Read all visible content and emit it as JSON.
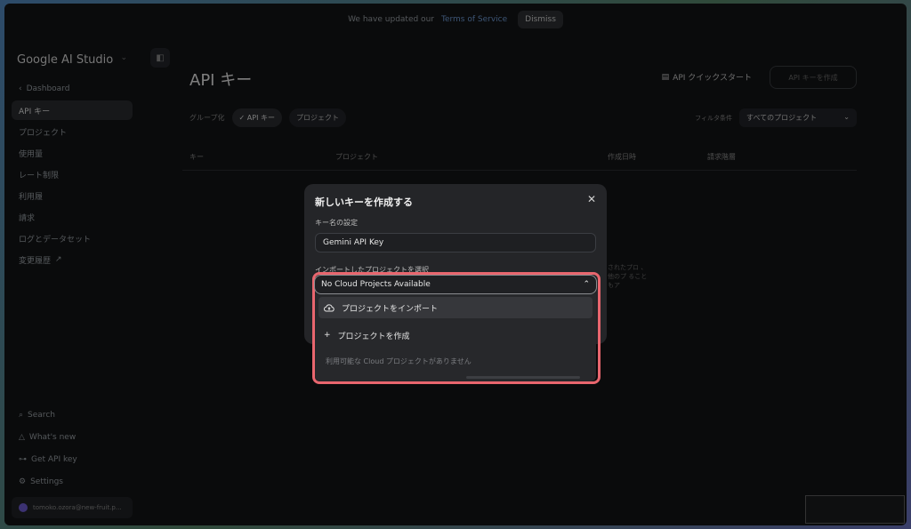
{
  "banner": {
    "text": "We have updated our",
    "link": "Terms of Service",
    "dismiss": "Dismiss"
  },
  "sidebar": {
    "logo": "Google AI Studio",
    "items": [
      {
        "label": "Dashboard"
      },
      {
        "label": "API キー"
      },
      {
        "label": "プロジェクト"
      },
      {
        "label": "使用量"
      },
      {
        "label": "レート制限"
      },
      {
        "label": "利用履"
      },
      {
        "label": "請求"
      },
      {
        "label": "ログとデータセット"
      },
      {
        "label": "変更履歴"
      }
    ],
    "bottom": [
      {
        "label": "Search"
      },
      {
        "label": "What's new"
      },
      {
        "label": "Get API key"
      },
      {
        "label": "Settings"
      }
    ],
    "user": "tomoko.ozora@new-fruit.p..."
  },
  "main": {
    "title": "API キー",
    "quickstart": "API クイックスタート",
    "create_key": "API キーを作成",
    "group_label": "グループ化",
    "chips": [
      "API キー",
      "プロジェクト"
    ],
    "filter_label": "フィルタ条件",
    "filter_value": "すべてのプロジェクト",
    "columns": [
      "キー",
      "プロジェクト",
      "作成日時",
      "請求階層"
    ],
    "bg_text": "されたプロ 、他のプ ることもア"
  },
  "modal": {
    "title": "新しいキーを作成する",
    "name_label": "キー名の設定",
    "name_value": "Gemini API Key",
    "project_label": "インポートしたプロジェクトを選択",
    "select_value": "No Cloud Projects Available",
    "menu": [
      {
        "label": "プロジェクトをインポート",
        "icon": "cloud-upload-icon"
      },
      {
        "label": "プロジェクトを作成",
        "icon": "plus-icon"
      }
    ],
    "empty_note": "利用可能な Cloud プロジェクトがありません"
  },
  "colors": {
    "highlight": "#e8666e",
    "background": "#131416"
  }
}
